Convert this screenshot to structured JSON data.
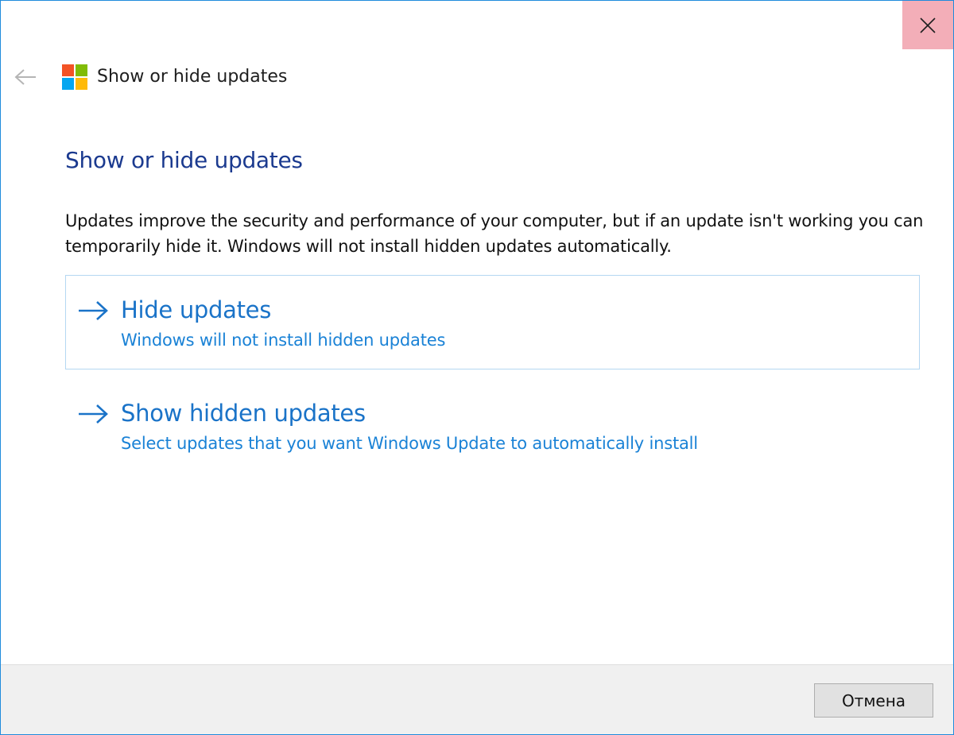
{
  "window": {
    "title": "Show or hide updates"
  },
  "page": {
    "heading": "Show or hide updates",
    "description": "Updates improve the security and performance of your computer, but if an update isn't working you can temporarily hide it. Windows will not install hidden updates automatically."
  },
  "options": [
    {
      "title": "Hide updates",
      "subtitle": "Windows will not install hidden updates",
      "icon": "arrow-right-icon"
    },
    {
      "title": "Show hidden updates",
      "subtitle": "Select updates that you want Windows Update to automatically install",
      "icon": "arrow-right-icon"
    }
  ],
  "footer": {
    "cancel_label": "Отмена"
  },
  "colors": {
    "heading": "#1b3a8f",
    "link": "#1a73c8",
    "close_hover": "#f3aeb8",
    "window_border": "#1f8bdc"
  }
}
